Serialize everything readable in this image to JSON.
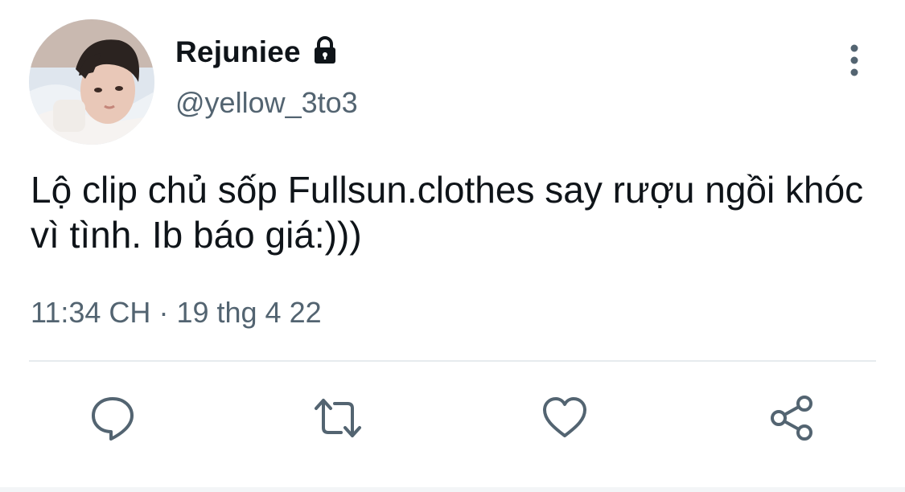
{
  "user": {
    "display_name": "Rejuniee",
    "handle": "@yellow_3to3",
    "protected_icon": "lock-icon",
    "avatar_icon": "avatar"
  },
  "tweet": {
    "text": "Lộ clip chủ sốp Fullsun.clothes say rượu ngồi khóc vì tình. Ib báo giá:)))",
    "time": "11:34 CH",
    "separator": "·",
    "date": "19 thg 4 22"
  },
  "actions": [
    {
      "name": "reply",
      "icon": "reply-icon"
    },
    {
      "name": "retweet",
      "icon": "retweet-icon"
    },
    {
      "name": "like",
      "icon": "heart-icon"
    },
    {
      "name": "share",
      "icon": "share-icon"
    }
  ],
  "colors": {
    "text_primary": "#0f1419",
    "text_secondary": "#536471",
    "icon_gray": "#536471",
    "divider": "#e6ebee"
  }
}
